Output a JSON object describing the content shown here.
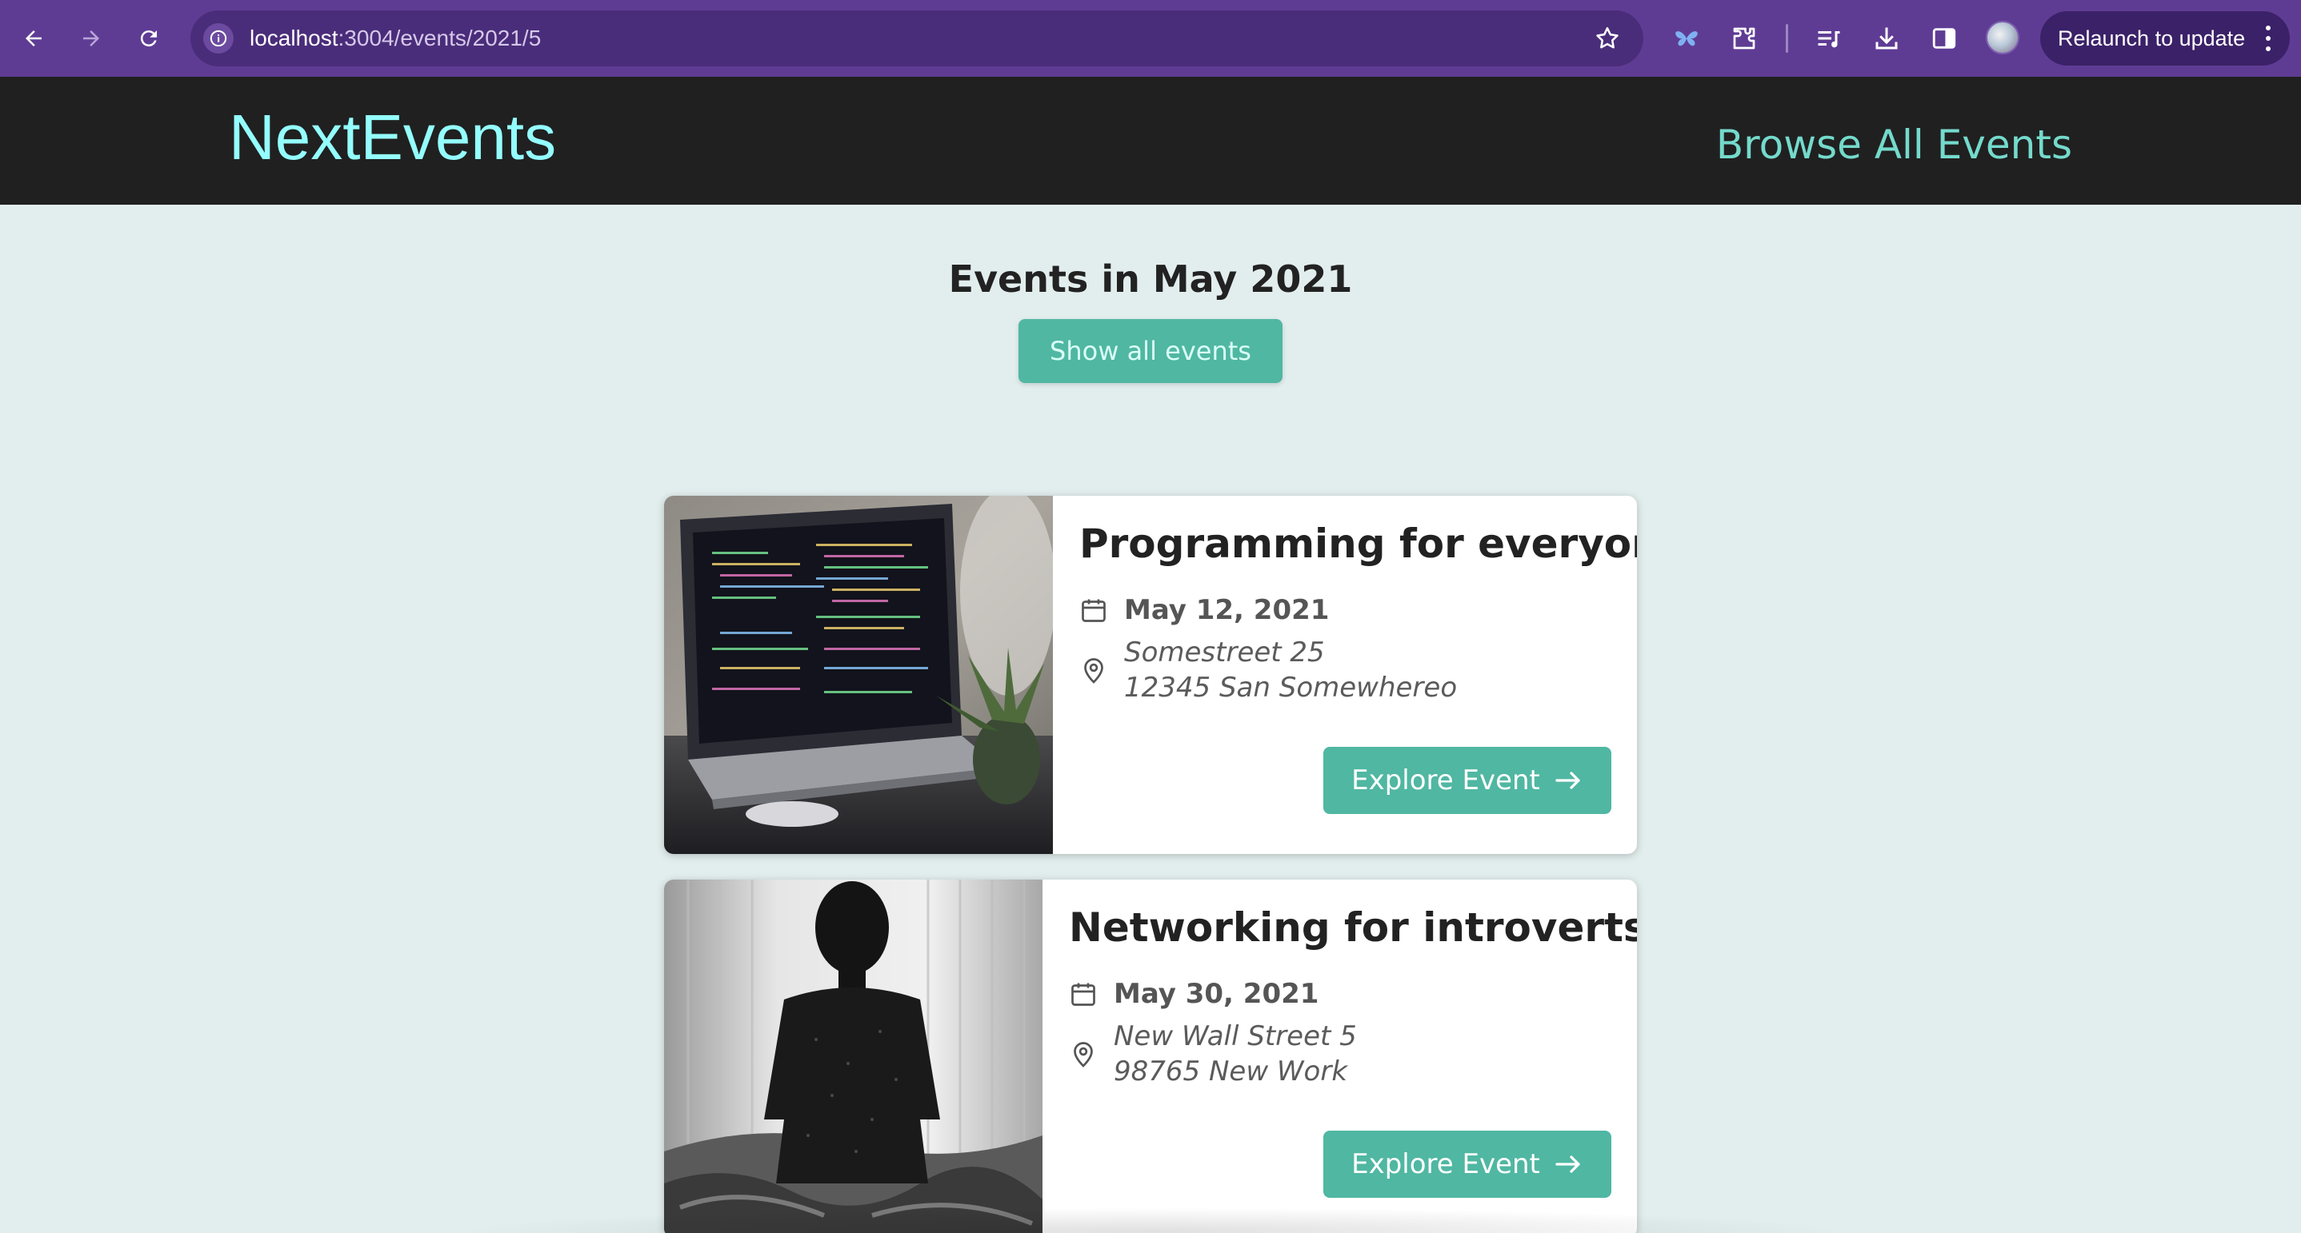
{
  "browser": {
    "url_host": "localhost",
    "url_path": ":3004/events/2021/5",
    "relaunch_label": "Relaunch to update"
  },
  "header": {
    "logo": "NextEvents",
    "browse_link": "Browse All Events"
  },
  "results": {
    "title": "Events in May 2021",
    "show_all_label": "Show all events"
  },
  "events": [
    {
      "title": "Programming for everyone",
      "date": "May 12, 2021",
      "address_line1": "Somestreet 25",
      "address_line2": "12345 San Somewhereo",
      "button_label": "Explore Event"
    },
    {
      "title": "Networking for introverts",
      "date": "May 30, 2021",
      "address_line1": "New Wall Street 5",
      "address_line2": "98765 New Work",
      "button_label": "Explore Event"
    }
  ],
  "colors": {
    "chrome": "#5f3c94",
    "header_bg": "#202020",
    "logo": "#94fdfd",
    "accent": "#50b7a2",
    "page_bg": "#e2eeed"
  }
}
